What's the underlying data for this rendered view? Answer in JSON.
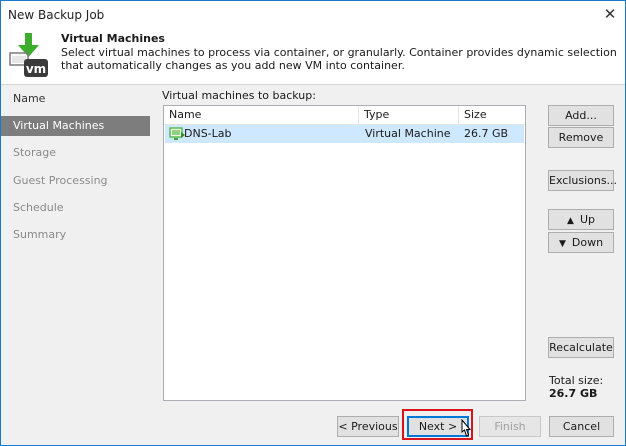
{
  "window": {
    "title": "New Backup Job",
    "close_glyph": "✕"
  },
  "header": {
    "title": "Virtual Machines",
    "description": "Select virtual machines to process via container, or granularly. Container provides dynamic selection that automatically changes as you add new VM into container.",
    "logo_icon": "vm-download-icon",
    "logo_text": "vm"
  },
  "sidebar": {
    "items": [
      {
        "label": "Name",
        "state": "done"
      },
      {
        "label": "Virtual Machines",
        "state": "active"
      },
      {
        "label": "Storage",
        "state": "pending"
      },
      {
        "label": "Guest Processing",
        "state": "pending"
      },
      {
        "label": "Schedule",
        "state": "pending"
      },
      {
        "label": "Summary",
        "state": "pending"
      }
    ]
  },
  "main": {
    "section_label": "Virtual machines to backup:",
    "columns": [
      "Name",
      "Type",
      "Size"
    ],
    "rows": [
      {
        "name": "DNS-Lab",
        "type": "Virtual Machine",
        "size": "26.7 GB",
        "icon": "virtual-machine-icon",
        "selected": true
      }
    ],
    "buttons": {
      "add": "Add...",
      "remove": "Remove",
      "exclusions": "Exclusions...",
      "up": "Up",
      "down": "Down",
      "recalculate": "Recalculate"
    },
    "total_size_label": "Total size:",
    "total_size_value": "26.7 GB"
  },
  "footer": {
    "previous": "< Previous",
    "next": "Next >",
    "finish": "Finish",
    "cancel": "Cancel"
  },
  "colors": {
    "accent": "#1979ca",
    "selection": "#cde8ff",
    "active_step": "#7d7d7d",
    "highlight": "#d9141c",
    "logo_green": "#3dae2b"
  }
}
